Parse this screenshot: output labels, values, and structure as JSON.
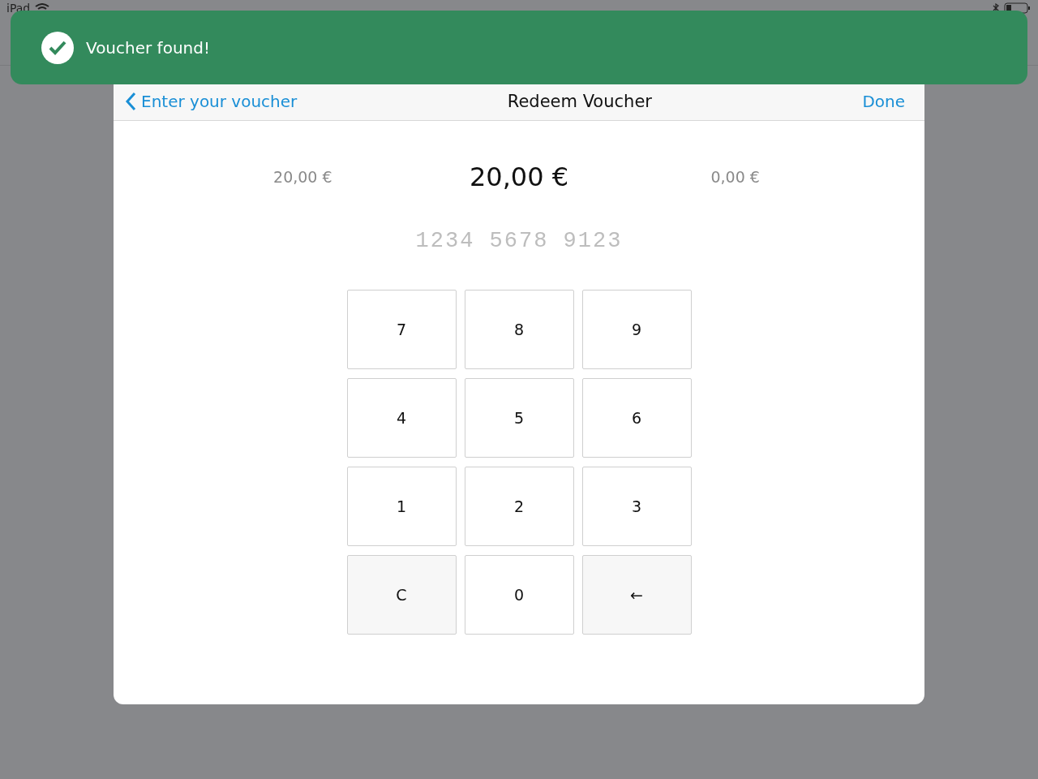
{
  "status_bar": {
    "device": "iPad"
  },
  "toast": {
    "message": "Voucher found!"
  },
  "modal": {
    "back_label": "Enter your voucher",
    "title": "Redeem Voucher",
    "done_label": "Done"
  },
  "amounts": [
    {
      "kind": "side",
      "text": "20,00 €"
    },
    {
      "kind": "main",
      "text": "20,00 €"
    },
    {
      "kind": "side",
      "text": "0,00 €"
    }
  ],
  "voucher_field": {
    "placeholder": "1234 5678 9123"
  },
  "keypad": [
    {
      "label": "7",
      "kind": "digit"
    },
    {
      "label": "8",
      "kind": "digit"
    },
    {
      "label": "9",
      "kind": "digit"
    },
    {
      "label": "4",
      "kind": "digit"
    },
    {
      "label": "5",
      "kind": "digit"
    },
    {
      "label": "6",
      "kind": "digit"
    },
    {
      "label": "1",
      "kind": "digit"
    },
    {
      "label": "2",
      "kind": "digit"
    },
    {
      "label": "3",
      "kind": "digit"
    },
    {
      "label": "C",
      "kind": "action"
    },
    {
      "label": "0",
      "kind": "digit"
    },
    {
      "label": "←",
      "kind": "action"
    }
  ]
}
